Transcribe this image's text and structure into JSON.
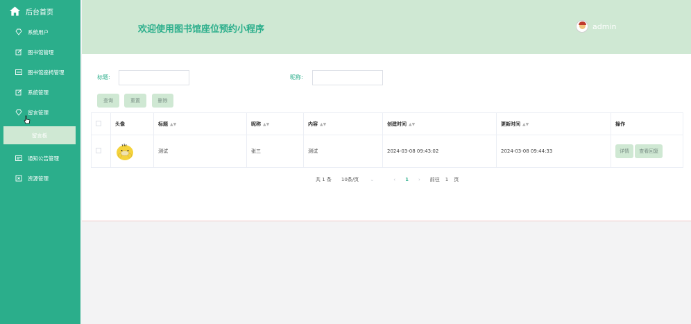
{
  "sidebar": {
    "home": "后台首页",
    "items": [
      {
        "label": "系统用户",
        "icon": "diamond-icon"
      },
      {
        "label": "图书馆管理",
        "icon": "edit-icon"
      },
      {
        "label": "图书馆座椅管理",
        "icon": "seat-icon"
      },
      {
        "label": "系统管理",
        "icon": "edit-icon"
      },
      {
        "label": "留言管理",
        "icon": "diamond-icon"
      },
      {
        "label": "通知公告管理",
        "icon": "notice-icon"
      },
      {
        "label": "资源管理",
        "icon": "resource-icon"
      }
    ],
    "sub_item": "留言板"
  },
  "header": {
    "title": "欢迎使用图书馆座位预约小程序",
    "user": "admin"
  },
  "search": {
    "title_label": "标题:",
    "nickname_label": "昵称:",
    "query_button": "查询",
    "reset_button": "重置",
    "delete_button": "删除"
  },
  "table": {
    "headers": [
      "头像",
      "标题",
      "昵称",
      "内容",
      "创建时间",
      "更新时间",
      "操作"
    ],
    "rows": [
      {
        "title": "测试",
        "nickname": "张三",
        "content": "测试",
        "created": "2024-03-08 09:43:02",
        "updated": "2024-03-08 09:44:33",
        "actions": [
          "详情",
          "查看回复"
        ]
      }
    ]
  },
  "pagination": {
    "total": "共 1 条",
    "page_size": "10条/页",
    "current": "1",
    "goto_label": "前往",
    "goto_value": "1",
    "page_unit": "页"
  },
  "colors": {
    "sidebar": "#2bae8b",
    "header": "#cfe8d3",
    "accent": "#2bae8b"
  }
}
